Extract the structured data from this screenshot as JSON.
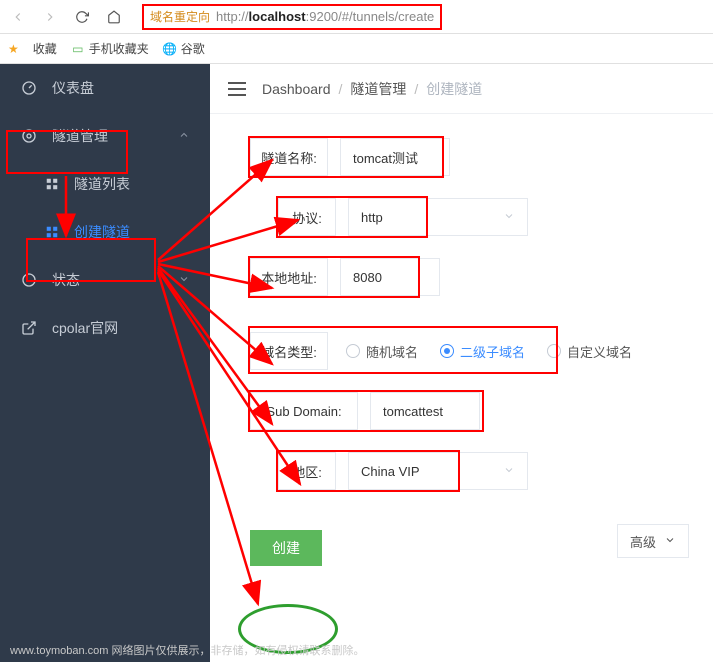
{
  "browser": {
    "redirect_label": "域名重定向",
    "url_prefix": "http://",
    "url_host": "localhost",
    "url_port": ":9200/",
    "url_hash": "#/tunnels/create",
    "favorites_label": "收藏",
    "mobile_fav": "手机收藏夹",
    "google": "谷歌"
  },
  "sidebar": {
    "dashboard": "仪表盘",
    "tunnel_mgmt": "隧道管理",
    "tunnel_list": "隧道列表",
    "create_tunnel": "创建隧道",
    "status": "状态",
    "cpolar_site": "cpolar官网"
  },
  "breadcrumb": {
    "dashboard": "Dashboard",
    "tunnel_mgmt": "隧道管理",
    "create_tunnel": "创建隧道"
  },
  "form": {
    "name_label": "隧道名称:",
    "name_value": "tomcat测试",
    "proto_label": "协议:",
    "proto_value": "http",
    "addr_label": "本地地址:",
    "addr_value": "8080",
    "domain_type_label": "域名类型:",
    "radio_random": "随机域名",
    "radio_sub": "二级子域名",
    "radio_custom": "自定义域名",
    "subdomain_label": "Sub Domain:",
    "subdomain_value": "tomcattest",
    "region_label": "地区:",
    "region_value": "China VIP",
    "advanced": "高级",
    "create": "创建"
  },
  "footer": "www.toymoban.com 网络图片仅供展示，非存储，如有侵权请联系删除。"
}
